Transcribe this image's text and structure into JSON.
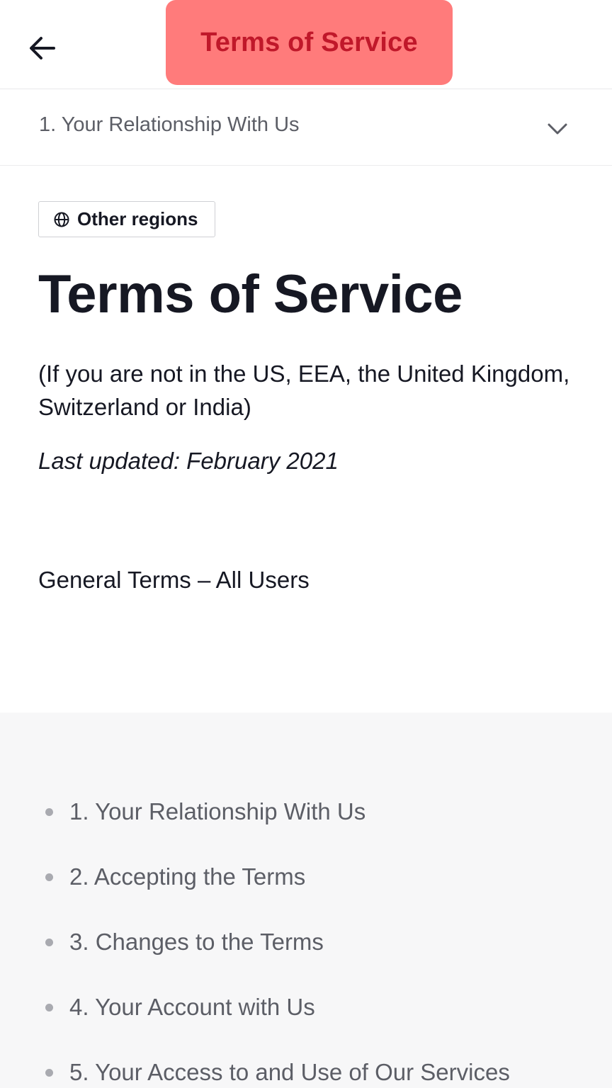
{
  "header": {
    "title": "Terms of Service"
  },
  "section_select": {
    "current": "1. Your Relationship With Us"
  },
  "region_button": {
    "label": "Other regions"
  },
  "content": {
    "title": "Terms of Service",
    "scope": "(If you are not in the US, EEA, the United Kingdom, Switzerland or India)",
    "updated": "Last updated: February 2021",
    "general_heading": "General Terms – All Users"
  },
  "toc": {
    "items": [
      {
        "label": "1. Your Relationship With Us"
      },
      {
        "label": "2. Accepting the Terms"
      },
      {
        "label": "3. Changes to the Terms"
      },
      {
        "label": "4. Your Account with Us"
      },
      {
        "label": "5. Your Access to and Use of Our Services"
      }
    ]
  },
  "colors": {
    "title_highlight": "#ff7b7b",
    "title_text": "#c0182a",
    "text": "#161823",
    "muted": "#5c5e66",
    "toc_bg": "#f7f7f8"
  },
  "icons": {
    "back": "arrow-left-icon",
    "chevron": "chevron-down-icon",
    "globe": "globe-icon"
  }
}
